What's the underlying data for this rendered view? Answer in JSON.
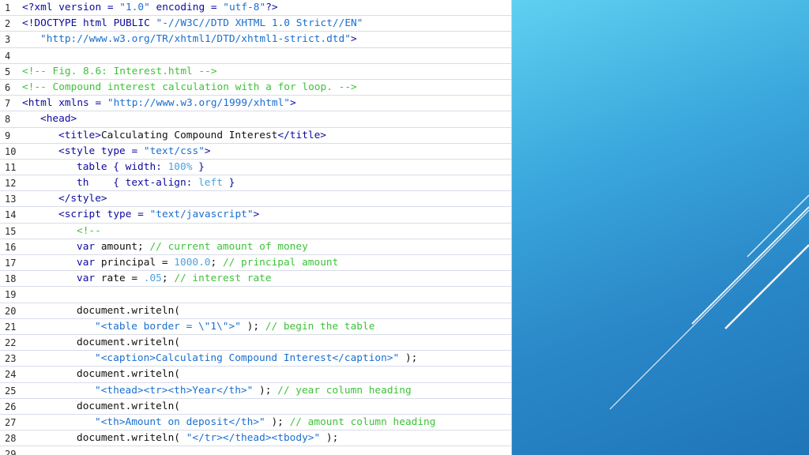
{
  "code_lines": [
    {
      "num": "1",
      "indent": 0,
      "tokens": [
        {
          "t": "<?xml version = ",
          "c": "tag"
        },
        {
          "t": "\"1.0\"",
          "c": "str"
        },
        {
          "t": " encoding = ",
          "c": "tag"
        },
        {
          "t": "\"utf-8\"",
          "c": "str"
        },
        {
          "t": "?>",
          "c": "tag"
        }
      ]
    },
    {
      "num": "2",
      "indent": 0,
      "tokens": [
        {
          "t": "<!DOCTYPE html PUBLIC ",
          "c": "tag"
        },
        {
          "t": "\"-//W3C//DTD XHTML 1.0 Strict//EN\"",
          "c": "str"
        }
      ]
    },
    {
      "num": "3",
      "indent": 1,
      "tokens": [
        {
          "t": "\"http://www.w3.org/TR/xhtml1/DTD/xhtml1-strict.dtd\"",
          "c": "str"
        },
        {
          "t": ">",
          "c": "tag"
        }
      ]
    },
    {
      "num": "4",
      "indent": 0,
      "tokens": []
    },
    {
      "num": "5",
      "indent": 0,
      "tokens": [
        {
          "t": "<!-- Fig. 8.6: Interest.html -->",
          "c": "cmt"
        }
      ]
    },
    {
      "num": "6",
      "indent": 0,
      "tokens": [
        {
          "t": "<!-- Compound interest calculation with a for loop. -->",
          "c": "cmt"
        }
      ]
    },
    {
      "num": "7",
      "indent": 0,
      "tokens": [
        {
          "t": "<html xmlns = ",
          "c": "tag"
        },
        {
          "t": "\"http://www.w3.org/1999/xhtml\"",
          "c": "str"
        },
        {
          "t": ">",
          "c": "tag"
        }
      ]
    },
    {
      "num": "8",
      "indent": 1,
      "tokens": [
        {
          "t": "<head>",
          "c": "tag"
        }
      ]
    },
    {
      "num": "9",
      "indent": 2,
      "tokens": [
        {
          "t": "<title>",
          "c": "tag"
        },
        {
          "t": "Calculating Compound Interest",
          "c": "txt"
        },
        {
          "t": "</title>",
          "c": "tag"
        }
      ]
    },
    {
      "num": "10",
      "indent": 2,
      "tokens": [
        {
          "t": "<style type = ",
          "c": "tag"
        },
        {
          "t": "\"text/css\"",
          "c": "str"
        },
        {
          "t": ">",
          "c": "tag"
        }
      ]
    },
    {
      "num": "11",
      "indent": 3,
      "tokens": [
        {
          "t": "table { width: ",
          "c": "kw"
        },
        {
          "t": "100%",
          "c": "num-lit"
        },
        {
          "t": " }",
          "c": "kw"
        }
      ]
    },
    {
      "num": "12",
      "indent": 3,
      "tokens": [
        {
          "t": "th    { text-align: ",
          "c": "kw"
        },
        {
          "t": "left",
          "c": "num-lit"
        },
        {
          "t": " }",
          "c": "kw"
        }
      ]
    },
    {
      "num": "13",
      "indent": 2,
      "tokens": [
        {
          "t": "</style>",
          "c": "tag"
        }
      ]
    },
    {
      "num": "14",
      "indent": 2,
      "tokens": [
        {
          "t": "<script type = ",
          "c": "tag"
        },
        {
          "t": "\"text/javascript\"",
          "c": "str"
        },
        {
          "t": ">",
          "c": "tag"
        }
      ]
    },
    {
      "num": "15",
      "indent": 3,
      "tokens": [
        {
          "t": "<!--",
          "c": "cmt"
        }
      ]
    },
    {
      "num": "16",
      "indent": 3,
      "tokens": [
        {
          "t": "var ",
          "c": "kw"
        },
        {
          "t": "amount; ",
          "c": "txt"
        },
        {
          "t": "// current amount of money",
          "c": "cmt"
        }
      ]
    },
    {
      "num": "17",
      "indent": 3,
      "tokens": [
        {
          "t": "var ",
          "c": "kw"
        },
        {
          "t": "principal = ",
          "c": "txt"
        },
        {
          "t": "1000.0",
          "c": "num-lit"
        },
        {
          "t": "; ",
          "c": "txt"
        },
        {
          "t": "// principal amount",
          "c": "cmt"
        }
      ]
    },
    {
      "num": "18",
      "indent": 3,
      "tokens": [
        {
          "t": "var ",
          "c": "kw"
        },
        {
          "t": "rate = ",
          "c": "txt"
        },
        {
          "t": ".05",
          "c": "num-lit"
        },
        {
          "t": "; ",
          "c": "txt"
        },
        {
          "t": "// interest rate",
          "c": "cmt"
        }
      ]
    },
    {
      "num": "19",
      "indent": 0,
      "tokens": []
    },
    {
      "num": "20",
      "indent": 3,
      "tokens": [
        {
          "t": "document.writeln(",
          "c": "txt"
        }
      ]
    },
    {
      "num": "21",
      "indent": 4,
      "tokens": [
        {
          "t": "\"<table border = \\\"1\\\">\"",
          "c": "str"
        },
        {
          "t": " ); ",
          "c": "txt"
        },
        {
          "t": "// begin the table",
          "c": "cmt"
        }
      ]
    },
    {
      "num": "22",
      "indent": 3,
      "tokens": [
        {
          "t": "document.writeln(",
          "c": "txt"
        }
      ]
    },
    {
      "num": "23",
      "indent": 4,
      "tokens": [
        {
          "t": "\"<caption>Calculating Compound Interest</caption>\"",
          "c": "str"
        },
        {
          "t": " );",
          "c": "txt"
        }
      ]
    },
    {
      "num": "24",
      "indent": 3,
      "tokens": [
        {
          "t": "document.writeln(",
          "c": "txt"
        }
      ]
    },
    {
      "num": "25",
      "indent": 4,
      "tokens": [
        {
          "t": "\"<thead><tr><th>Year</th>\"",
          "c": "str"
        },
        {
          "t": " ); ",
          "c": "txt"
        },
        {
          "t": "// year column heading",
          "c": "cmt"
        }
      ]
    },
    {
      "num": "26",
      "indent": 3,
      "tokens": [
        {
          "t": "document.writeln(",
          "c": "txt"
        }
      ]
    },
    {
      "num": "27",
      "indent": 4,
      "tokens": [
        {
          "t": "\"<th>Amount on deposit</th>\"",
          "c": "str"
        },
        {
          "t": " ); ",
          "c": "txt"
        },
        {
          "t": "// amount column heading",
          "c": "cmt"
        }
      ]
    },
    {
      "num": "28",
      "indent": 3,
      "tokens": [
        {
          "t": "document.writeln( ",
          "c": "txt"
        },
        {
          "t": "\"</tr></thead><tbody>\"",
          "c": "str"
        },
        {
          "t": " );",
          "c": "txt"
        }
      ]
    },
    {
      "num": "29",
      "indent": 0,
      "tokens": []
    }
  ],
  "colors": {
    "tag": "#0b0b9f",
    "string": "#1a6fcf",
    "comment": "#3fc23a",
    "keyword": "#0b0b9f",
    "number": "#4aa3df",
    "panel_gradient_start": "#5fd0f0",
    "panel_gradient_end": "#1f75b8"
  }
}
